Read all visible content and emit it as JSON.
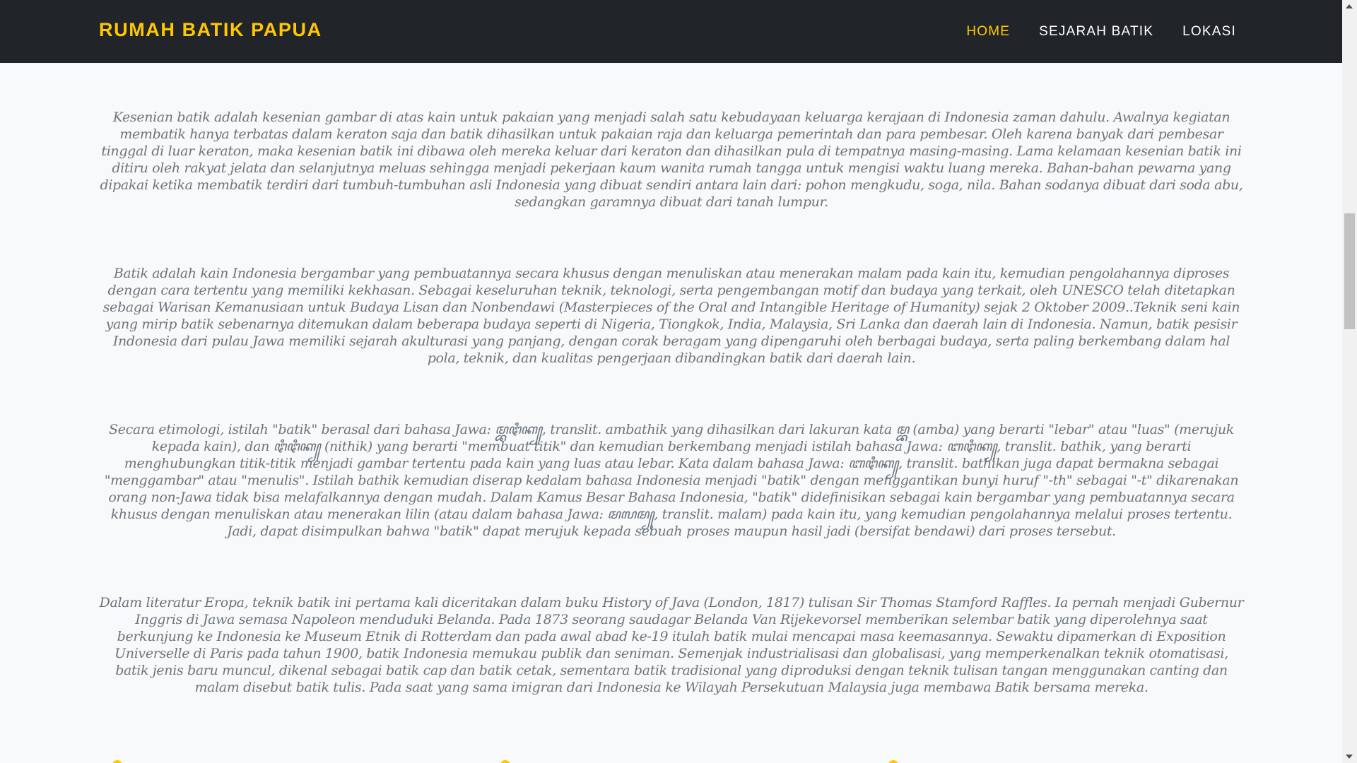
{
  "navbar": {
    "brand": "RUMAH BATIK PAPUA",
    "links": [
      {
        "label": "HOME",
        "active": true
      },
      {
        "label": "SEJARAH BATIK",
        "active": false
      },
      {
        "label": "LOKASI",
        "active": false
      }
    ]
  },
  "main": {
    "paragraphs": [
      "Kesenian batik adalah kesenian gambar di atas kain untuk pakaian yang menjadi salah satu kebudayaan keluarga kerajaan di Indonesia zaman dahulu. Awalnya kegiatan membatik hanya terbatas dalam keraton saja dan batik dihasilkan untuk pakaian raja dan keluarga pemerintah dan para pembesar. Oleh karena banyak dari pembesar tinggal di luar keraton, maka kesenian batik ini dibawa oleh mereka keluar dari keraton dan dihasilkan pula di tempatnya masing-masing. Lama kelamaan kesenian batik ini ditiru oleh rakyat jelata dan selanjutnya meluas sehingga menjadi pekerjaan kaum wanita rumah tangga untuk mengisi waktu luang mereka. Bahan-bahan pewarna yang dipakai ketika membatik terdiri dari tumbuh-tumbuhan asli Indonesia yang dibuat sendiri antara lain dari: pohon mengkudu, soga, nila. Bahan sodanya dibuat dari soda abu, sedangkan garamnya dibuat dari tanah lumpur.",
      "Batik adalah kain Indonesia bergambar yang pembuatannya secara khusus dengan menuliskan atau menerakan malam pada kain itu, kemudian pengolahannya diproses dengan cara tertentu yang memiliki kekhasan. Sebagai keseluruhan teknik, teknologi, serta pengembangan motif dan budaya yang terkait, oleh UNESCO telah ditetapkan sebagai Warisan Kemanusiaan untuk Budaya Lisan dan Nonbendawi (Masterpieces of the Oral and Intangible Heritage of Humanity) sejak 2 Oktober 2009..Teknik seni kain yang mirip batik sebenarnya ditemukan dalam beberapa budaya seperti di Nigeria, Tiongkok, India, Malaysia, Sri Lanka dan daerah lain di Indonesia. Namun, batik pesisir Indonesia dari pulau Jawa memiliki sejarah akulturasi yang panjang, dengan corak beragam yang dipengaruhi oleh berbagai budaya, serta paling berkembang dalam hal pola, teknik, dan kualitas pengerjaan dibandingkan batik dari daerah lain.",
      "Secara etimologi, istilah \"batik\" berasal dari bahasa Jawa: ꦩ꧀ꦧꦛꦶꦏ꧀, translit. ambathik yang dihasilkan dari lakuran kata ꦩ꧀ꦧ (amba) yang berarti \"lebar\" atau \"luas\" (merujuk kepada kain), dan ꦛꦶꦛꦶꦏ꧀ (nithik) yang berarti \"membuat titik\" dan kemudian berkembang menjadi istilah bahasa Jawa: ꦧꦛꦶꦏ꧀, translit. bathik, yang berarti menghubungkan titik-titik menjadi gambar tertentu pada kain yang luas atau lebar. Kata dalam bahasa Jawa: ꦧꦛꦶꦏ꧀, translit. bathikan juga dapat bermakna sebagai \"menggambar\" atau \"menulis\". Istilah bathik kemudian diserap kedalam bahasa Indonesia menjadi \"batik\" dengan menggantikan bunyi huruf \"-th\" sebagai \"-t\" dikarenakan orang non-Jawa tidak bisa melafalkannya dengan mudah. Dalam Kamus Besar Bahasa Indonesia, \"batik\" didefinisikan sebagai kain bergambar yang pembuatannya secara khusus dengan menuliskan atau menerakan lilin (atau dalam bahasa Jawa: ꦩꦭꦩ꧀, translit. malam) pada kain itu, yang kemudian pengolahannya melalui proses tertentu. Jadi, dapat disimpulkan bahwa \"batik\" dapat merujuk kepada sebuah proses maupun hasil jadi (bersifat bendawi) dari proses tersebut.",
      "Dalam literatur Eropa, teknik batik ini pertama kali diceritakan dalam buku History of Java (London, 1817) tulisan Sir Thomas Stamford Raffles. Ia pernah menjadi Gubernur Inggris di Jawa semasa Napoleon menduduki Belanda. Pada 1873 seorang saudagar Belanda Van Rijekevorsel memberikan selembar batik yang diperolehnya saat berkunjung ke Indonesia ke Museum Etnik di Rotterdam dan pada awal abad ke-19 itulah batik mulai mencapai masa keemasannya. Sewaktu dipamerkan di Exposition Universelle di Paris pada tahun 1900, batik Indonesia memukau publik dan seniman. Semenjak industrialisasi dan globalisasi, yang memperkenalkan teknik otomatisasi, batik jenis baru muncul, dikenal sebagai batik cap dan batik cetak, sementara batik tradisional yang diproduksi dengan teknik tulisan tangan menggunakan canting dan malam disebut batik tulis. Pada saat yang sama imigran dari Indonesia ke Wilayah Persekutuan Malaysia juga membawa Batik bersama mereka."
    ]
  },
  "colors": {
    "navbar_bg": "#212529",
    "accent": "#ffc800",
    "body_text": "#6c757d",
    "page_bg": "#f8f9fa"
  }
}
